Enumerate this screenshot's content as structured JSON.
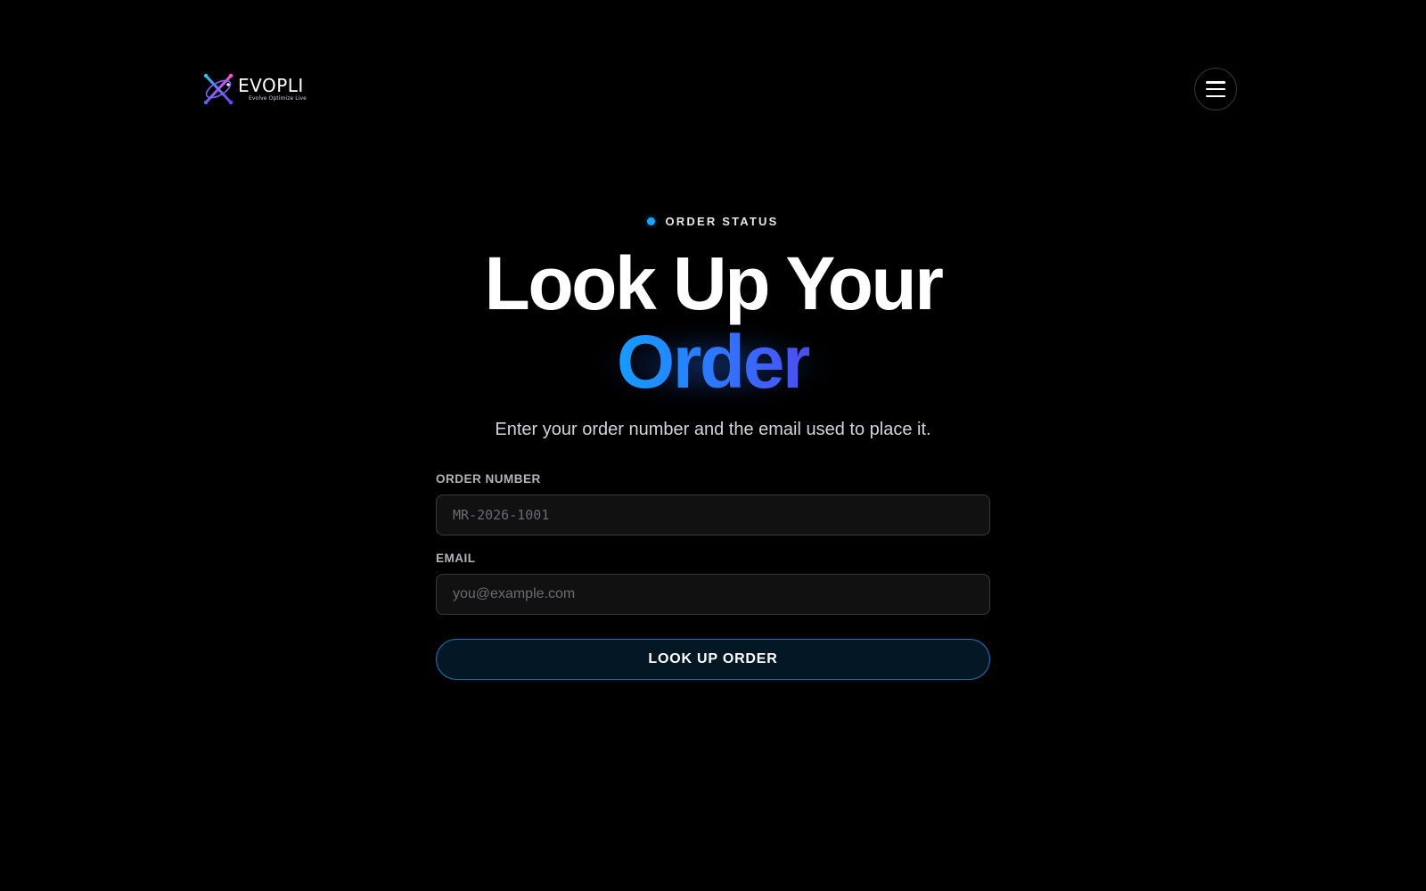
{
  "header": {
    "logo_word": "EVOPLI",
    "logo_tagline": "Evolve Optimize Live",
    "menu_icon": "hamburger-menu-icon"
  },
  "hero": {
    "eyebrow": "ORDER STATUS",
    "title_line1": "Look Up Your",
    "title_line2": "Order",
    "subtitle": "Enter your order number and the email used to place it."
  },
  "form": {
    "order_number_label": "ORDER NUMBER",
    "order_number_placeholder": "MR-2026-1001",
    "order_number_value": "",
    "email_label": "EMAIL",
    "email_placeholder": "you@example.com",
    "email_value": "",
    "submit_label": "LOOK UP ORDER"
  },
  "colors": {
    "background": "#000000",
    "accent_blue": "#1aa3ff",
    "gradient_start": "#159cff",
    "gradient_end": "#4e4cf0",
    "button_border": "#1477b8",
    "button_fill": "#041724"
  }
}
